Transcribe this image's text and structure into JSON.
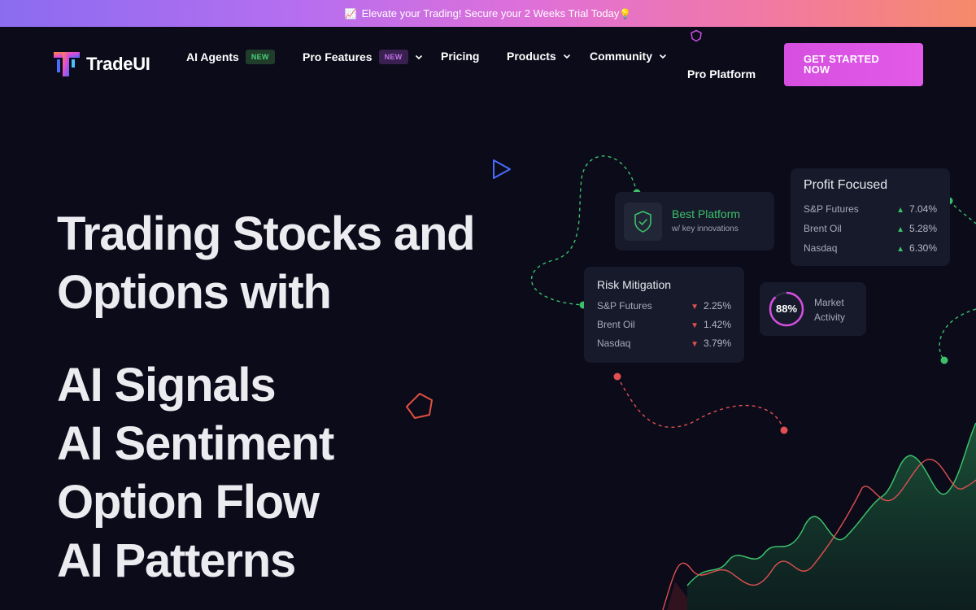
{
  "banner": {
    "emoji": "📈",
    "text": "Elevate your Trading! Secure your 2 Weeks Trial Today",
    "trailing_emoji": "💡"
  },
  "brand": {
    "name": "TradeUI"
  },
  "nav": {
    "ai_agents": {
      "label": "AI Agents",
      "badge": "NEW"
    },
    "pro_features": {
      "label": "Pro Features",
      "badge": "NEW"
    },
    "pricing": {
      "label": "Pricing"
    },
    "products": {
      "label": "Products"
    },
    "community": {
      "label": "Community"
    },
    "pro_platform": {
      "label": "Pro Platform"
    },
    "cta": {
      "label": "GET STARTED NOW"
    }
  },
  "hero": {
    "line1": "Trading Stocks and",
    "line2": "Options with",
    "features": [
      "AI Signals",
      "AI Sentiment",
      "Option Flow",
      "AI Patterns"
    ]
  },
  "cards": {
    "best_platform": {
      "title": "Best Platform",
      "subtitle": "w/ key innovations"
    },
    "profit_focused": {
      "title": "Profit Focused",
      "rows": [
        {
          "name": "S&P Futures",
          "change": "7.04%"
        },
        {
          "name": "Brent Oil",
          "change": "5.28%"
        },
        {
          "name": "Nasdaq",
          "change": "6.30%"
        }
      ]
    },
    "risk_mitigation": {
      "title": "Risk Mitigation",
      "rows": [
        {
          "name": "S&P Futures",
          "change": "2.25%"
        },
        {
          "name": "Brent Oil",
          "change": "1.42%"
        },
        {
          "name": "Nasdaq",
          "change": "3.79%"
        }
      ]
    },
    "market_activity": {
      "value": "88%",
      "label_line1": "Market",
      "label_line2": "Activity",
      "fraction": 0.88
    }
  },
  "colors": {
    "accent": "#e35ae8",
    "up": "#3cc06a",
    "down": "#e05050",
    "background": "#0b0b1a",
    "card": "#161a2a"
  }
}
